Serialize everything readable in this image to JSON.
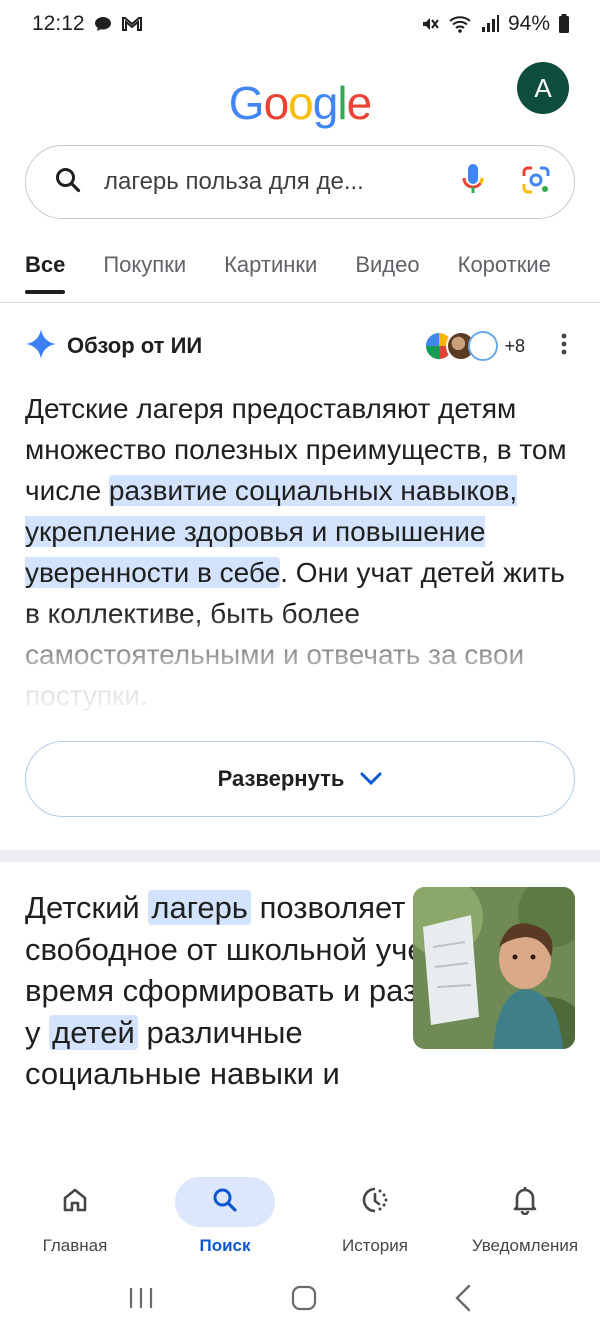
{
  "status_bar": {
    "time": "12:12",
    "battery": "94%",
    "icons": [
      "chat-icon",
      "gmail-icon",
      "mute-icon",
      "wifi-icon",
      "signal-icon",
      "battery-icon"
    ]
  },
  "header": {
    "logo_letters": [
      {
        "ch": "G",
        "color": "#4285f4"
      },
      {
        "ch": "o",
        "color": "#ea4335"
      },
      {
        "ch": "o",
        "color": "#fbbc05"
      },
      {
        "ch": "g",
        "color": "#4285f4"
      },
      {
        "ch": "l",
        "color": "#34a853"
      },
      {
        "ch": "e",
        "color": "#ea4335"
      }
    ],
    "avatar_letter": "A"
  },
  "search": {
    "query": "лагерь польза для де...",
    "icons": [
      "search-icon",
      "mic-icon",
      "lens-icon"
    ]
  },
  "tabs": [
    {
      "label": "Все",
      "active": true
    },
    {
      "label": "Покупки",
      "active": false
    },
    {
      "label": "Картинки",
      "active": false
    },
    {
      "label": "Видео",
      "active": false
    },
    {
      "label": "Короткие",
      "active": false
    }
  ],
  "ai_overview": {
    "title": "Обзор от ИИ",
    "sources_more": "+8",
    "text_before": "Детские лагеря предоставляют детям множество полезных преимуществ, в том числе ",
    "text_highlight": "развитие социальных навыков, укрепление здоровья и повышение уверенности в себе",
    "text_after": ". Они учат детей жить в коллективе, быть более самостоятельными и отвечать за свои поступки.",
    "expand_label": "Развернуть"
  },
  "result": {
    "part1": "Детский ",
    "hl1": "лагерь",
    "part2": " позволяет в свободное от школьной учебы время сформировать и развить у ",
    "hl2": "детей",
    "part3": " различные социальные навыки и"
  },
  "bottom_nav": [
    {
      "label": "Главная",
      "icon": "home-icon",
      "active": false
    },
    {
      "label": "Поиск",
      "icon": "search-icon",
      "active": true
    },
    {
      "label": "История",
      "icon": "history-icon",
      "active": false
    },
    {
      "label": "Уведомления",
      "icon": "bell-icon",
      "active": false
    }
  ],
  "colors": {
    "accent": "#0b57d0",
    "highlight": "#d3e3fd",
    "avatar_bg": "#0f4d3c"
  }
}
